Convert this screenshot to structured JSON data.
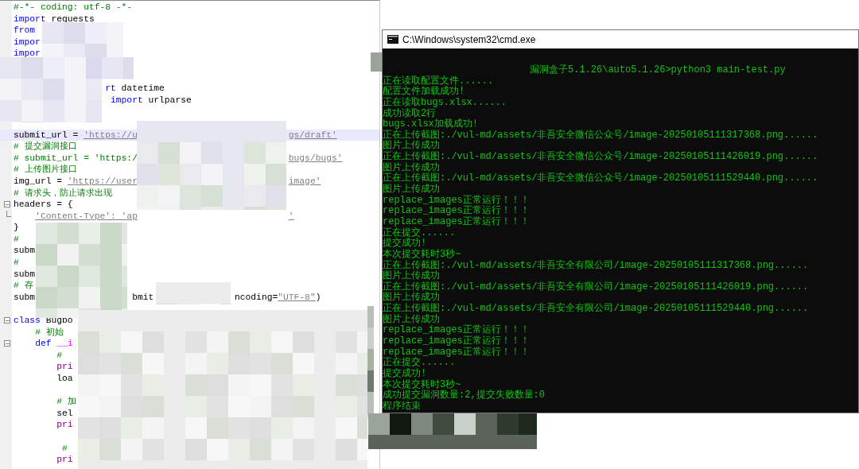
{
  "editor": {
    "lines": [
      {
        "parts": [
          {
            "text": "#-*- coding: utf-8 -*-",
            "kind": "comment"
          }
        ],
        "current": false
      },
      {
        "parts": [
          {
            "text": "import",
            "kind": "keyword"
          },
          {
            "text": " requests",
            "kind": "plain"
          }
        ],
        "current": false
      },
      {
        "parts": [
          {
            "text": "from",
            "kind": "keyword"
          }
        ],
        "current": false
      },
      {
        "parts": [
          {
            "text": "impor",
            "kind": "keyword"
          }
        ],
        "current": false
      },
      {
        "parts": [
          {
            "text": "impor",
            "kind": "keyword"
          }
        ],
        "current": false
      },
      {
        "current": false
      },
      {
        "current": false
      },
      {
        "parts": [
          {
            "text": "                 rt",
            "kind": "keyword"
          },
          {
            "text": " datetime",
            "kind": "plain"
          }
        ],
        "current": false
      },
      {
        "parts": [
          {
            "text": "                  import",
            "kind": "keyword"
          },
          {
            "text": " urlparse",
            "kind": "plain"
          }
        ],
        "current": false
      },
      {
        "current": false
      },
      {
        "current": false
      },
      {
        "parts": [
          {
            "text": "submit_url = ",
            "kind": "plain"
          },
          {
            "text": "'https://u",
            "kind": "string"
          },
          {
            "text": "                            gs/draft'",
            "kind": "string"
          }
        ],
        "current": true
      },
      {
        "parts": [
          {
            "text": "# 提交漏洞接口",
            "kind": "comment"
          }
        ],
        "current": false
      },
      {
        "parts": [
          {
            "text": "# submit_url = 'https:/",
            "kind": "comment"
          },
          {
            "text": "                            bugs/bugs'",
            "kind": "string"
          }
        ],
        "current": false
      },
      {
        "parts": [
          {
            "text": "# 上传图片接口",
            "kind": "comment"
          }
        ],
        "current": false
      },
      {
        "parts": [
          {
            "text": "img_url = ",
            "kind": "plain"
          },
          {
            "text": "'https://user",
            "kind": "string"
          },
          {
            "text": "                            image'",
            "kind": "string"
          }
        ],
        "current": false
      },
      {
        "parts": [
          {
            "text": "# 请求头，防止请求出现",
            "kind": "comment"
          }
        ],
        "current": false
      },
      {
        "parts": [
          {
            "text": "headers = {",
            "kind": "plain"
          }
        ],
        "current": false,
        "fold_start": true
      },
      {
        "parts": [
          {
            "text": "    'Content-Type': 'ap",
            "kind": "string"
          },
          {
            "text": "                            '",
            "kind": "string"
          }
        ],
        "current": false,
        "fold_end": true
      },
      {
        "parts": [
          {
            "text": "}",
            "kind": "plain"
          }
        ],
        "current": false
      },
      {
        "parts": [
          {
            "text": "#",
            "kind": "comment"
          }
        ],
        "current": false
      },
      {
        "parts": [
          {
            "text": "subm",
            "kind": "plain"
          }
        ],
        "current": false
      },
      {
        "parts": [
          {
            "text": "#",
            "kind": "comment"
          }
        ],
        "current": false
      },
      {
        "parts": [
          {
            "text": "subm",
            "kind": "plain"
          }
        ],
        "current": false
      },
      {
        "parts": [
          {
            "text": "# 存",
            "kind": "comment"
          }
        ],
        "current": false
      },
      {
        "parts": [
          {
            "text": "subm",
            "kind": "plain"
          },
          {
            "text": "                  bmit",
            "kind": "plain"
          },
          {
            "text": "               ncoding=",
            "kind": "plain"
          },
          {
            "text": "\"UTF-8\"",
            "kind": "string"
          },
          {
            "text": ")",
            "kind": "plain"
          }
        ],
        "current": false
      },
      {
        "current": false
      },
      {
        "parts": [
          {
            "text": "class",
            "kind": "keyword"
          },
          {
            "text": " Bugbo",
            "kind": "plain"
          }
        ],
        "current": false,
        "fold_start": true
      },
      {
        "parts": [
          {
            "text": "    # 初始",
            "kind": "comment"
          }
        ],
        "current": false
      },
      {
        "parts": [
          {
            "text": "    def",
            "kind": "keyword"
          },
          {
            "text": " __i",
            "kind": "magic"
          }
        ],
        "current": false,
        "fold_start": true
      },
      {
        "parts": [
          {
            "text": "        #",
            "kind": "comment"
          }
        ],
        "current": false
      },
      {
        "parts": [
          {
            "text": "        pri",
            "kind": "print"
          }
        ],
        "current": false
      },
      {
        "parts": [
          {
            "text": "        loa",
            "kind": "plain"
          }
        ],
        "current": false
      },
      {
        "current": false
      },
      {
        "parts": [
          {
            "text": "        # 加",
            "kind": "comment"
          }
        ],
        "current": false
      },
      {
        "parts": [
          {
            "text": "        sel",
            "kind": "plain"
          }
        ],
        "current": false
      },
      {
        "parts": [
          {
            "text": "        pri",
            "kind": "print"
          }
        ],
        "current": false
      },
      {
        "current": false
      },
      {
        "parts": [
          {
            "text": "         #",
            "kind": "comment"
          }
        ],
        "current": false
      },
      {
        "parts": [
          {
            "text": "        pri",
            "kind": "print"
          }
        ],
        "current": false
      }
    ]
  },
  "console": {
    "title": "C:\\Windows\\system32\\cmd.exe",
    "lines": [
      {
        "text": "漏洞盒子5.1.26\\auto5.1.26>python3 main-test.py",
        "kind": "prompt"
      },
      {
        "text": "正在读取配置文件......",
        "kind": "output"
      },
      {
        "text": "配置文件加载成功!",
        "kind": "output"
      },
      {
        "text": "正在读取bugs.xlsx......",
        "kind": "output"
      },
      {
        "text": "成功读取2行",
        "kind": "output"
      },
      {
        "text": "bugs.xlsx加载成功!",
        "kind": "output"
      },
      {
        "text": "正在上传截图:./vul-md/assets/非吾安全微信公众号/image-20250105111317368.png......",
        "kind": "output"
      },
      {
        "text": "图片上传成功",
        "kind": "output"
      },
      {
        "text": "正在上传截图:./vul-md/assets/非吾安全微信公众号/image-20250105111426019.png......",
        "kind": "output"
      },
      {
        "text": "图片上传成功",
        "kind": "output"
      },
      {
        "text": "正在上传截图:./vul-md/assets/非吾安全微信公众号/image-20250105111529440.png......",
        "kind": "output"
      },
      {
        "text": "图片上传成功",
        "kind": "output"
      },
      {
        "text": "replace_images正常运行！！！",
        "kind": "output"
      },
      {
        "text": "replace_images正常运行！！！",
        "kind": "output"
      },
      {
        "text": "replace_images正常运行！！！",
        "kind": "output"
      },
      {
        "text": "正在提交......",
        "kind": "output"
      },
      {
        "text": "提交成功!",
        "kind": "output"
      },
      {
        "text": "本次提交耗时3秒~",
        "kind": "output"
      },
      {
        "text": "正在上传截图:./vul-md/assets/非吾安全有限公司/image-20250105111317368.png......",
        "kind": "output"
      },
      {
        "text": "图片上传成功",
        "kind": "output"
      },
      {
        "text": "正在上传截图:./vul-md/assets/非吾安全有限公司/image-20250105111426019.png......",
        "kind": "output"
      },
      {
        "text": "图片上传成功",
        "kind": "output"
      },
      {
        "text": "正在上传截图:./vul-md/assets/非吾安全有限公司/image-20250105111529440.png......",
        "kind": "output"
      },
      {
        "text": "图片上传成功",
        "kind": "output"
      },
      {
        "text": "replace_images正常运行！！！",
        "kind": "output"
      },
      {
        "text": "replace_images正常运行！！！",
        "kind": "output"
      },
      {
        "text": "replace_images正常运行！！！",
        "kind": "output"
      },
      {
        "text": "正在提交......",
        "kind": "output"
      },
      {
        "text": "提交成功!",
        "kind": "output"
      },
      {
        "text": "本次提交耗时3秒~",
        "kind": "output"
      },
      {
        "text": "成功提交漏洞数量:2,提交失败数量:0",
        "kind": "output"
      },
      {
        "text": "程序结束",
        "kind": "output"
      }
    ]
  }
}
